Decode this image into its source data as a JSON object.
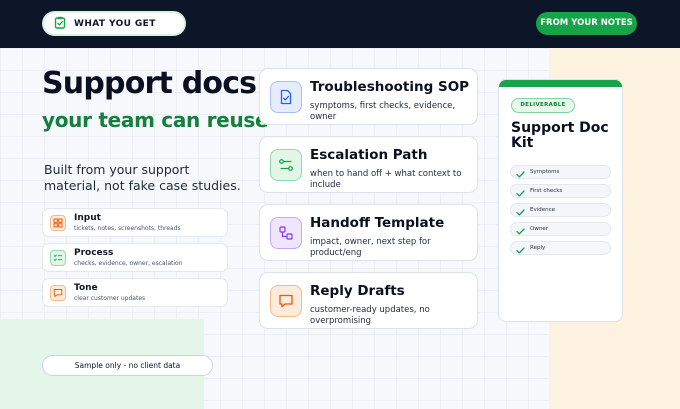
{
  "header": {
    "left_pill": "WHAT YOU GET",
    "right_pill": "FROM YOUR NOTES"
  },
  "hero": {
    "title": "Support docs",
    "subtitle": "your team can reuse",
    "description": "Built from your support material, not fake case studies."
  },
  "inputs": [
    {
      "title": "Input",
      "desc": "tickets, notes, screenshots, threads",
      "icon": "grid-icon",
      "color": "#ea580c"
    },
    {
      "title": "Process",
      "desc": "checks, evidence, owner, escalation",
      "icon": "checklist-icon",
      "color": "#16a34a"
    },
    {
      "title": "Tone",
      "desc": "clear customer updates",
      "icon": "chat-icon",
      "color": "#ea580c"
    }
  ],
  "sample_note": "Sample only - no client data",
  "cards": [
    {
      "title": "Troubleshooting SOP",
      "desc": "symptoms, first checks, evidence, owner",
      "icon": "document-check-icon",
      "color": "#2563eb"
    },
    {
      "title": "Escalation Path",
      "desc": "when to hand off + what context to include",
      "icon": "path-icon",
      "color": "#16a34a"
    },
    {
      "title": "Handoff Template",
      "desc": "impact, owner, next step for product/eng",
      "icon": "handoff-icon",
      "color": "#7c3aed"
    },
    {
      "title": "Reply Drafts",
      "desc": "customer-ready updates, no overpromising",
      "icon": "chat-icon",
      "color": "#ea580c"
    }
  ],
  "kit": {
    "badge": "DELIVERABLE",
    "title": "Support Doc Kit",
    "items": [
      "Symptoms",
      "First checks",
      "Evidence",
      "Owner",
      "Reply"
    ]
  },
  "colors": {
    "accent": "#16a34a",
    "header_bg": "#0d1628"
  }
}
